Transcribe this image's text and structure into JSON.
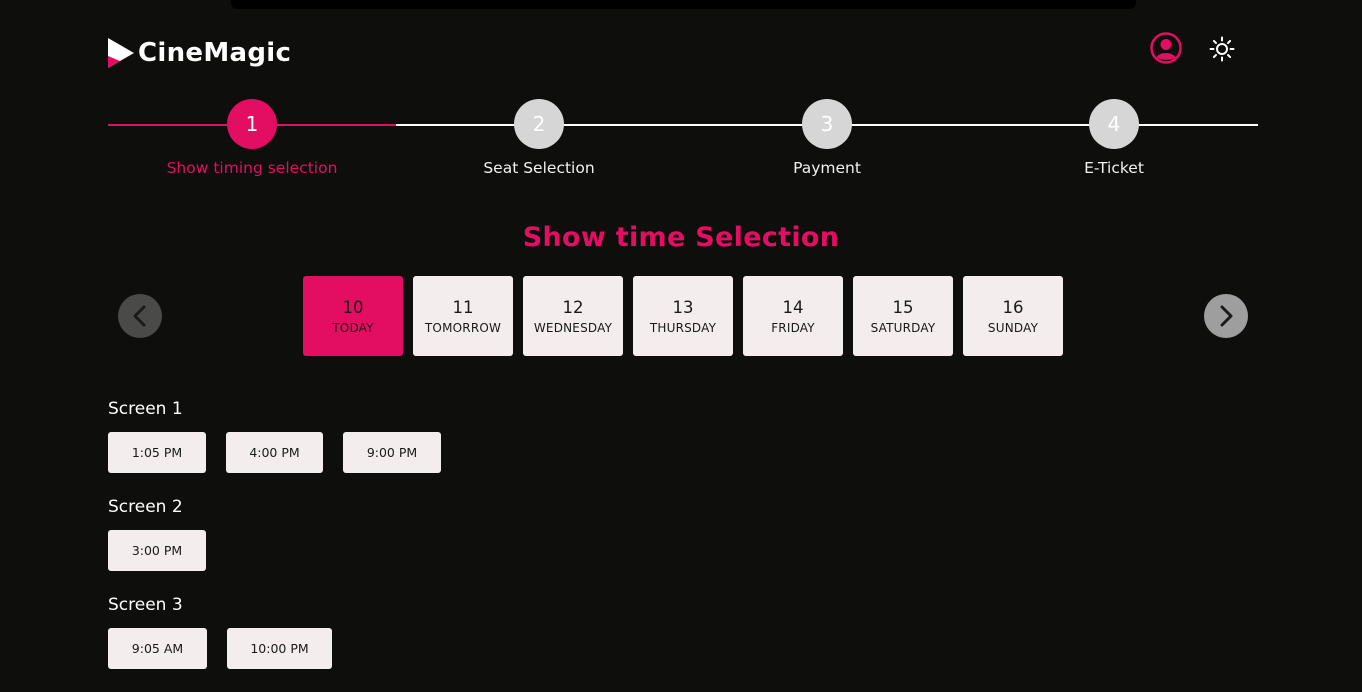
{
  "app": {
    "name": "CineMagic",
    "accent": "#e30e62"
  },
  "header": {
    "user_icon": "user-circle-icon",
    "theme_icon": "sun-icon"
  },
  "stepper": {
    "steps": [
      {
        "number": "1",
        "label": "Show timing selection",
        "state": "active"
      },
      {
        "number": "2",
        "label": "Seat Selection",
        "state": "inactive"
      },
      {
        "number": "3",
        "label": "Payment",
        "state": "inactive"
      },
      {
        "number": "4",
        "label": "E-Ticket",
        "state": "inactive"
      }
    ]
  },
  "main": {
    "title": "Show time Selection",
    "dates": [
      {
        "day": "10",
        "label": "TODAY",
        "selected": true
      },
      {
        "day": "11",
        "label": "TOMORROW",
        "selected": false
      },
      {
        "day": "12",
        "label": "WEDNESDAY",
        "selected": false
      },
      {
        "day": "13",
        "label": "THURSDAY",
        "selected": false
      },
      {
        "day": "14",
        "label": "FRIDAY",
        "selected": false
      },
      {
        "day": "15",
        "label": "SATURDAY",
        "selected": false
      },
      {
        "day": "16",
        "label": "SUNDAY",
        "selected": false
      }
    ],
    "screens": [
      {
        "name": "Screen 1",
        "times": [
          "1:05 PM",
          "4:00 PM",
          "9:00 PM"
        ]
      },
      {
        "name": "Screen 2",
        "times": [
          "3:00 PM"
        ]
      },
      {
        "name": "Screen 3",
        "times": [
          "9:05 AM",
          "10:00 PM"
        ]
      }
    ]
  }
}
